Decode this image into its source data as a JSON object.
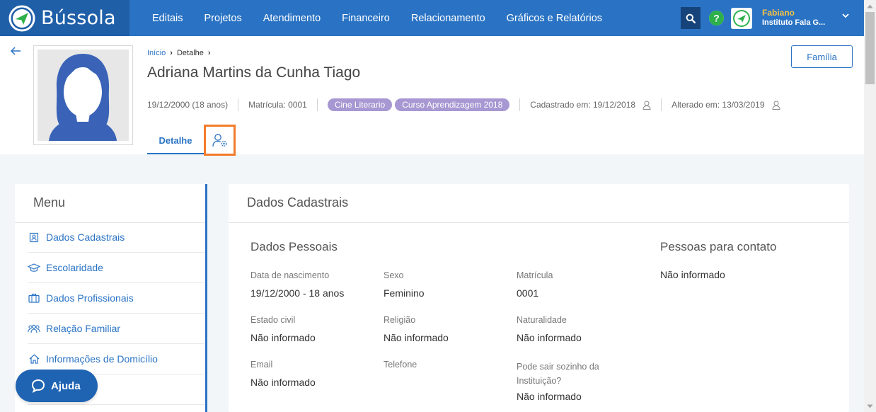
{
  "app": {
    "name": "Bússola",
    "brand_color": "#2a73c4",
    "accent_orange": "#f27b2b"
  },
  "nav": {
    "items": [
      "Editais",
      "Projetos",
      "Atendimento",
      "Financeiro",
      "Relacionamento",
      "Gráficos e Relatórios"
    ]
  },
  "user": {
    "name": "Fabiano",
    "org": "Instituto Fala G..."
  },
  "breadcrumb": {
    "home": "Início",
    "current": "Detalhe"
  },
  "person": {
    "name": "Adriana Martins da Cunha Tiago",
    "birth": "19/12/2000 (18 anos)",
    "enrollment": "Matrícula: 0001",
    "tags": [
      "Cine Literario",
      "Curso Aprendizagem 2018"
    ],
    "created": "Cadastrado em: 19/12/2018",
    "updated": "Alterado em: 13/03/2019"
  },
  "header": {
    "family_button": "Família",
    "tab_detail": "Detalhe"
  },
  "menu": {
    "title": "Menu",
    "items": [
      {
        "label": "Dados Cadastrais",
        "icon": "id-card-icon"
      },
      {
        "label": "Escolaridade",
        "icon": "graduation-cap-icon"
      },
      {
        "label": "Dados Profissionais",
        "icon": "briefcase-icon"
      },
      {
        "label": "Relação Familiar",
        "icon": "family-icon"
      },
      {
        "label": "Informações de Domicílio",
        "icon": "home-icon"
      },
      {
        "label": "",
        "icon": ""
      }
    ]
  },
  "help": {
    "label": "Ajuda"
  },
  "card": {
    "title": "Dados Cadastrais",
    "personal_title": "Dados Pessoais",
    "contacts_title": "Pessoas para contato",
    "contacts_value": "Não informado",
    "fields": {
      "birth": {
        "label": "Data de nascimento",
        "value": "19/12/2000 - 18 anos"
      },
      "sex": {
        "label": "Sexo",
        "value": "Feminino"
      },
      "enrollment": {
        "label": "Matrícula",
        "value": "0001"
      },
      "civil": {
        "label": "Estado civil",
        "value": "Não informado"
      },
      "religion": {
        "label": "Religião",
        "value": "Não informado"
      },
      "origin": {
        "label": "Naturalidade",
        "value": "Não informado"
      },
      "email": {
        "label": "Email",
        "value": "Não informado"
      },
      "phone": {
        "label": "Telefone",
        "value": ""
      },
      "leave_alone": {
        "label": "Pode sair sozinho da Instituição?",
        "value": "Não informado"
      }
    }
  }
}
